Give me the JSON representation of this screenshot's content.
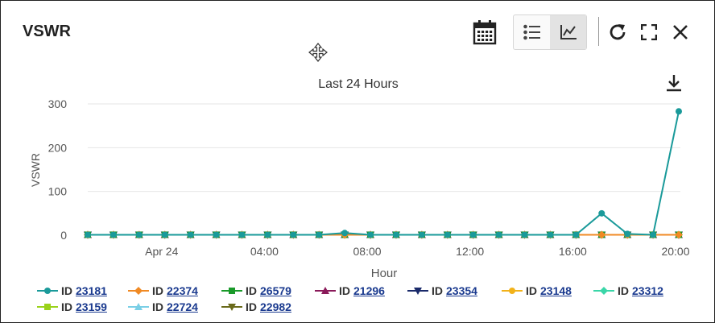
{
  "header": {
    "title": "VSWR"
  },
  "toolbar": {
    "icons": [
      "calendar-icon",
      "list-view-icon",
      "chart-view-icon",
      "refresh-icon",
      "fullscreen-icon",
      "close-icon"
    ],
    "active_view": "chart"
  },
  "chart_data": {
    "type": "line",
    "title": "Last 24 Hours",
    "xlabel": "Hour",
    "ylabel": "VSWR",
    "ylim": [
      0,
      300
    ],
    "y_ticks": [
      "0",
      "100",
      "200",
      "300"
    ],
    "x_ticks": [
      "Apr 24",
      "04:00",
      "08:00",
      "12:00",
      "16:00",
      "20:00"
    ],
    "x_hours": [
      0,
      1,
      2,
      3,
      4,
      5,
      6,
      7,
      8,
      9,
      10,
      11,
      12,
      13,
      14,
      15,
      16,
      17,
      18,
      19,
      20,
      21,
      22,
      23
    ],
    "series": [
      {
        "name": "ID 23181",
        "id_prefix": "ID",
        "id": "23181",
        "color": "#1a9a9a",
        "marker": "circle",
        "values": [
          1,
          1,
          1,
          1,
          1,
          1,
          1,
          1,
          1,
          1,
          5,
          1,
          1,
          1,
          1,
          1,
          1,
          1,
          1,
          1,
          50,
          3,
          1,
          283
        ]
      },
      {
        "name": "ID 22374",
        "id_prefix": "ID",
        "id": "22374",
        "color": "#f08a24",
        "marker": "diamond",
        "values": [
          1,
          1,
          1,
          1,
          1,
          1,
          1,
          1,
          1,
          1,
          1,
          1,
          1,
          1,
          1,
          1,
          1,
          1,
          1,
          1,
          1,
          1,
          1,
          1
        ]
      },
      {
        "name": "ID 26579",
        "id_prefix": "ID",
        "id": "26579",
        "color": "#1a9a2a",
        "marker": "square",
        "values": [
          1,
          1,
          1,
          1,
          1,
          1,
          1,
          1,
          1,
          1,
          1,
          1,
          1,
          1,
          1,
          1,
          1,
          1,
          1,
          1,
          1,
          1,
          1,
          1
        ]
      },
      {
        "name": "ID 21296",
        "id_prefix": "ID",
        "id": "21296",
        "color": "#8a1a5a",
        "marker": "triangle-up",
        "values": [
          1,
          1,
          1,
          1,
          1,
          1,
          1,
          1,
          1,
          1,
          1,
          1,
          1,
          1,
          1,
          1,
          1,
          1,
          1,
          1,
          1,
          1,
          1,
          1
        ]
      },
      {
        "name": "ID 23354",
        "id_prefix": "ID",
        "id": "23354",
        "color": "#1a2a6a",
        "marker": "triangle-down",
        "values": [
          1,
          1,
          1,
          1,
          1,
          1,
          1,
          1,
          1,
          1,
          1,
          1,
          1,
          1,
          1,
          1,
          1,
          1,
          1,
          1,
          1,
          1,
          1,
          1
        ]
      },
      {
        "name": "ID 23148",
        "id_prefix": "ID",
        "id": "23148",
        "color": "#f2b21a",
        "marker": "circle",
        "values": [
          1,
          1,
          1,
          1,
          1,
          1,
          1,
          1,
          1,
          1,
          1,
          1,
          1,
          1,
          1,
          1,
          1,
          1,
          1,
          1,
          1,
          1,
          1,
          1
        ]
      },
      {
        "name": "ID 23312",
        "id_prefix": "ID",
        "id": "23312",
        "color": "#3ad6a8",
        "marker": "diamond",
        "values": [
          1,
          1,
          1,
          1,
          1,
          1,
          1,
          1,
          1,
          1,
          1,
          1,
          1,
          1,
          1,
          1,
          1,
          1,
          1,
          1,
          1,
          1,
          1,
          1
        ]
      },
      {
        "name": "ID 23159",
        "id_prefix": "ID",
        "id": "23159",
        "color": "#9ad21a",
        "marker": "square",
        "values": [
          1,
          1,
          1,
          1,
          1,
          1,
          1,
          1,
          1,
          1,
          1,
          1,
          1,
          1,
          1,
          1,
          1,
          1,
          1,
          1,
          1,
          1,
          1,
          1
        ]
      },
      {
        "name": "ID 22724",
        "id_prefix": "ID",
        "id": "22724",
        "color": "#7acfe6",
        "marker": "triangle-up",
        "values": [
          1,
          1,
          1,
          1,
          1,
          1,
          1,
          1,
          1,
          1,
          1,
          1,
          1,
          1,
          1,
          1,
          1,
          1,
          1,
          1,
          1,
          1,
          1,
          1
        ]
      },
      {
        "name": "ID 22982",
        "id_prefix": "ID",
        "id": "22982",
        "color": "#6a6a1a",
        "marker": "triangle-down",
        "values": [
          1,
          1,
          1,
          1,
          1,
          1,
          1,
          1,
          1,
          1,
          1,
          1,
          1,
          1,
          1,
          1,
          1,
          1,
          1,
          1,
          1,
          1,
          1,
          1
        ]
      }
    ],
    "grid": true,
    "legend_placement": "bottom"
  }
}
